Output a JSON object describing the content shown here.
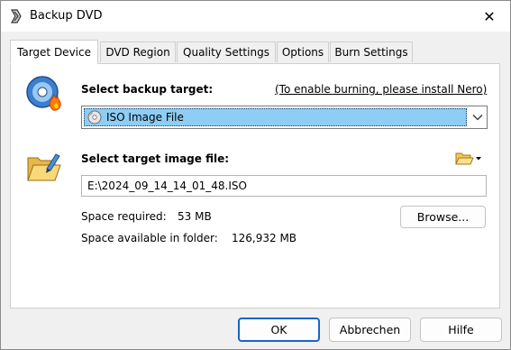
{
  "window": {
    "title": "Backup DVD",
    "icon": "backup-dvd-app-icon",
    "close_symbol": "✕"
  },
  "tabs": [
    {
      "label": "Target Device",
      "active": true
    },
    {
      "label": "DVD Region",
      "active": false
    },
    {
      "label": "Quality Settings",
      "active": false
    },
    {
      "label": "Options",
      "active": false
    },
    {
      "label": "Burn Settings",
      "active": false
    }
  ],
  "target": {
    "heading": "Select backup target:",
    "nero_link": "(To enable burning, please install Nero)",
    "selected_option": "ISO Image File",
    "option_icon": "disc-icon"
  },
  "image_file": {
    "heading": "Select target image file:",
    "path": "E:\\2024_09_14_14_01_48.ISO",
    "browse_label": "Browse...",
    "space_required_label": "Space required:",
    "space_required_value": "53 MB",
    "space_available_label": "Space available in folder:",
    "space_available_value": "126,932 MB"
  },
  "footer": {
    "ok_label": "OK",
    "cancel_label": "Abbrechen",
    "help_label": "Hilfe"
  },
  "colors": {
    "selection": "#8ecdf4",
    "link": "#1a4dc4",
    "default_button_border": "#1a64c8"
  }
}
